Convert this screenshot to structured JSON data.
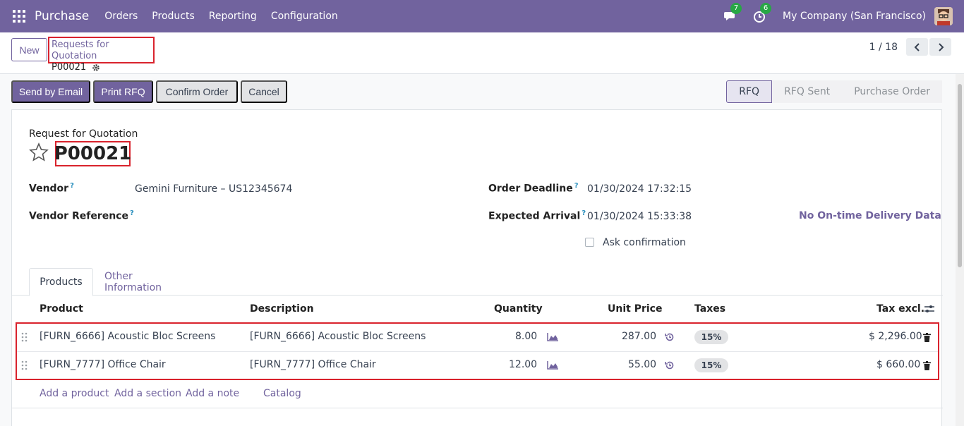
{
  "navbar": {
    "brand": "Purchase",
    "menu": [
      "Orders",
      "Products",
      "Reporting",
      "Configuration"
    ],
    "messages_badge": "7",
    "activities_badge": "6",
    "company": "My Company (San Francisco)"
  },
  "control_panel": {
    "new_label": "New",
    "breadcrumb_parent": "Requests for Quotation",
    "breadcrumb_current": "P00021",
    "pager_value": "1 / 18"
  },
  "actions": {
    "send_email": "Send by Email",
    "print_rfq": "Print RFQ",
    "confirm_order": "Confirm Order",
    "cancel": "Cancel"
  },
  "stages": [
    "RFQ",
    "RFQ Sent",
    "Purchase Order"
  ],
  "form": {
    "title_label": "Request for Quotation",
    "name": "P00021",
    "vendor_label": "Vendor",
    "vendor_value": "Gemini Furniture – US12345674",
    "vendor_ref_label": "Vendor Reference",
    "order_deadline_label": "Order Deadline",
    "order_deadline_value": "01/30/2024 17:32:15",
    "expected_arrival_label": "Expected Arrival",
    "expected_arrival_value": "01/30/2024 15:33:38",
    "ontime_label": "No On-time Delivery Data",
    "ask_confirmation_label": "Ask confirmation",
    "help_mark": "?"
  },
  "tabs": [
    "Products",
    "Other Information"
  ],
  "table": {
    "headers": {
      "product": "Product",
      "description": "Description",
      "quantity": "Quantity",
      "unit_price": "Unit Price",
      "taxes": "Taxes",
      "tax_excl": "Tax excl."
    },
    "rows": [
      {
        "product": "[FURN_6666] Acoustic Bloc Screens",
        "description": "[FURN_6666] Acoustic Bloc Screens",
        "quantity": "8.00",
        "unit_price": "287.00",
        "tax": "15%",
        "subtotal": "$ 2,296.00"
      },
      {
        "product": "[FURN_7777] Office Chair",
        "description": "[FURN_7777] Office Chair",
        "quantity": "12.00",
        "unit_price": "55.00",
        "tax": "15%",
        "subtotal": "$ 660.00"
      }
    ],
    "add_links": [
      "Add a product",
      "Add a section",
      "Add a note",
      "Catalog"
    ]
  },
  "colors": {
    "brand": "#71639e",
    "highlight": "#d9232d",
    "badge": "#28a745"
  }
}
